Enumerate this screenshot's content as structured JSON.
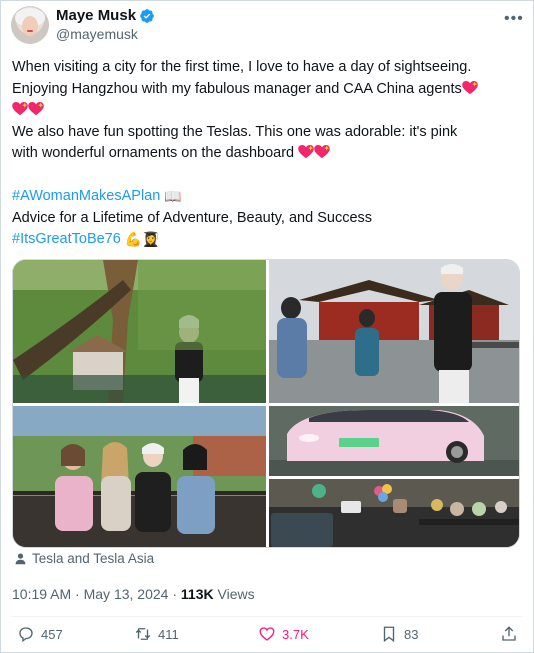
{
  "author": {
    "name": "Maye Musk",
    "handle": "@mayemusk"
  },
  "icons": {
    "verified": "verified-badge-icon",
    "more": "more-options-icon",
    "heart_emoji": "sparkling-heart-emoji",
    "book_emoji": "open-book-emoji",
    "muscle_emoji": "flexed-biceps-emoji",
    "graduate_emoji": "woman-student-emoji",
    "person": "person-icon",
    "reply": "reply-icon",
    "repost": "repost-icon",
    "like": "like-icon",
    "bookmark": "bookmark-icon",
    "share": "share-icon"
  },
  "colors": {
    "accent": "#1d9bf0",
    "like": "#f91880",
    "muted": "#536471",
    "text": "#0f1419"
  },
  "tweet": {
    "line1": "When visiting a city for the first time, I love to have a day of sightseeing.",
    "line2": "Enjoying Hangzhou with my fabulous manager and CAA China agents",
    "line4": "We also have fun spotting the Teslas. This one was adorable: it's pink",
    "line5": "with wonderful ornaments on the dashboard",
    "hashtag1": "#AWomanMakesAPlan",
    "book_emoji_char": "📖",
    "line7": "Advice for a Lifetime of Adventure, Beauty, and Success",
    "hashtag2": "#ItsGreatToBe76",
    "muscle_emoji_char": "💪",
    "graduate_emoji_char": "👩‍🎓"
  },
  "media": {
    "photo_count": 5,
    "tagged": "Tesla and Tesla Asia"
  },
  "meta": {
    "time": "10:19 AM",
    "separator": "·",
    "date": "May 13, 2024",
    "dot": "·",
    "views_count": "113K",
    "views_label": "Views"
  },
  "actions": {
    "replies": "457",
    "reposts": "411",
    "likes": "3.7K",
    "bookmarks": "83"
  }
}
